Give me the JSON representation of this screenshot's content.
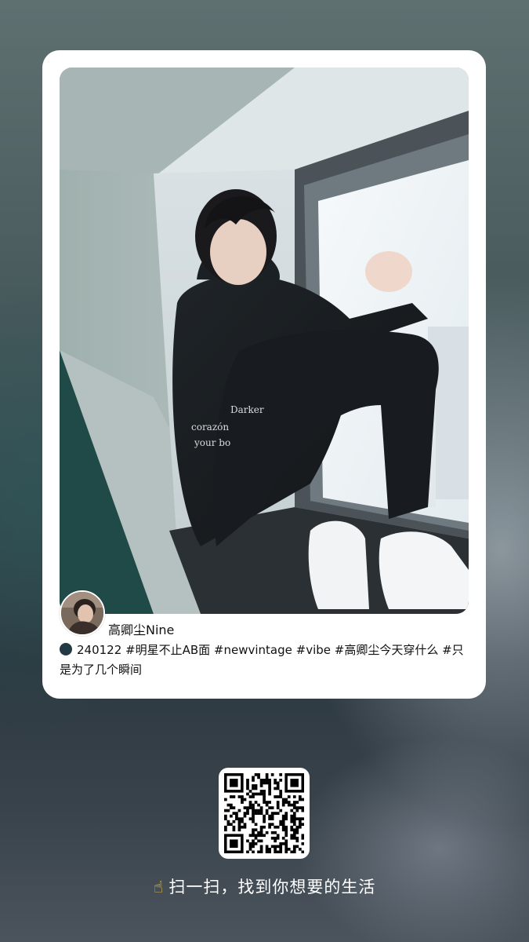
{
  "post": {
    "username": "高卿尘Nine",
    "caption": "240122 #明星不止AB面 #newvintage #vibe #高卿尘今天穿什么 #只是为了几个瞬间",
    "caption_dot_color": "#213a44",
    "photo_subject": "person in black hoodie sitting on window sill",
    "shirt_print": [
      "Darker",
      "corazón",
      "your bo"
    ]
  },
  "share": {
    "qr_label": "qr-code",
    "hand_icon": "pointing-up-hand-icon",
    "scan_text": "扫一扫，找到你想要的生活"
  }
}
